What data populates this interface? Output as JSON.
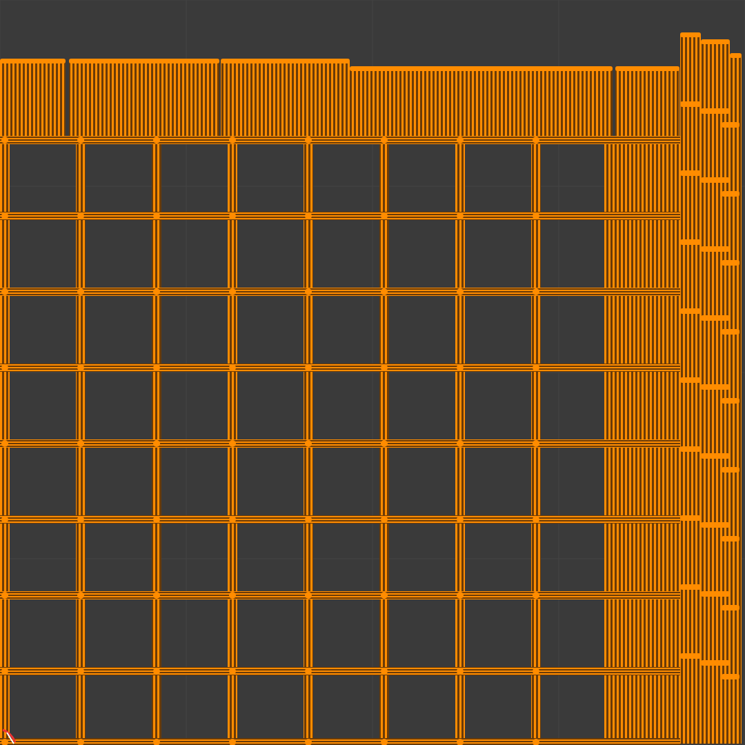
{
  "viewport": {
    "mesh_selected": true
  }
}
